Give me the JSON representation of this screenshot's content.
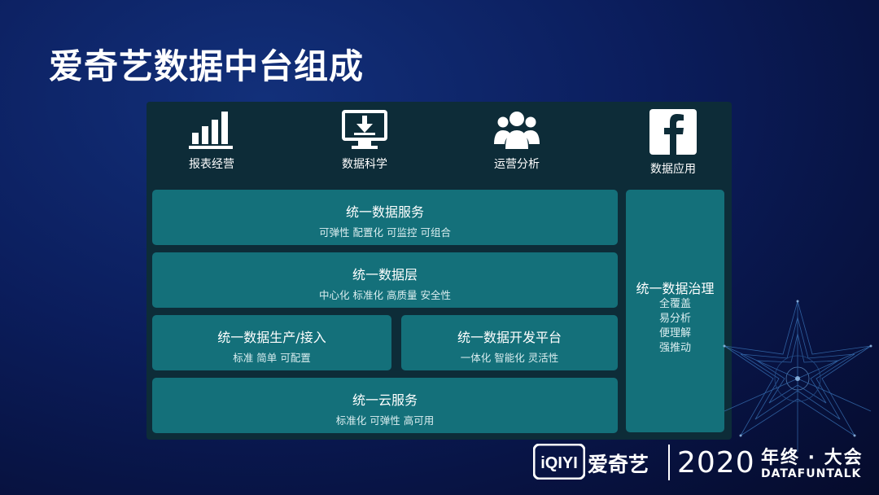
{
  "title": "爱奇艺数据中台组成",
  "icons": [
    {
      "icon": "bar-chart-icon",
      "label": "报表经营"
    },
    {
      "icon": "monitor-download-icon",
      "label": "数据科学"
    },
    {
      "icon": "users-group-icon",
      "label": "运营分析"
    },
    {
      "icon": "facebook-icon",
      "label": "数据应用"
    }
  ],
  "service": {
    "title": "统一数据服务",
    "sub": "可弹性 配置化 可监控 可组合"
  },
  "layer": {
    "title": "统一数据层",
    "sub": "中心化 标准化 高质量 安全性"
  },
  "production": {
    "title": "统一数据生产/接入",
    "sub": "标准 简单 可配置"
  },
  "devplatform": {
    "title": "统一数据开发平台",
    "sub": "一体化 智能化  灵活性"
  },
  "cloud": {
    "title": "统一云服务",
    "sub": "标准化 可弹性 高可用"
  },
  "governance": {
    "title": "统一数据治理",
    "items": [
      "全覆盖",
      "易分析",
      "便理解",
      "强推动"
    ]
  },
  "footer": {
    "logo_text": "iQIYI",
    "name": "爱奇艺",
    "year": "2020",
    "event": "年终 · 大会",
    "brand": "DATAFUNTALK"
  },
  "colors": {
    "panel": "#0d2c38",
    "box": "#14707a",
    "background": "#0b1d5c"
  }
}
